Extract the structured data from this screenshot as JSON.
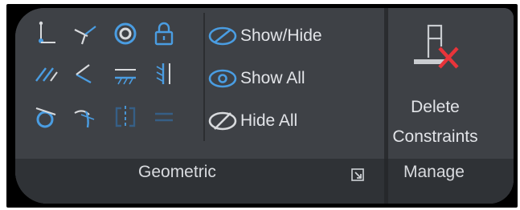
{
  "panels": {
    "geometric": {
      "title": "Geometric",
      "constraint_icons": [
        "coincident-icon",
        "collinear-icon",
        "concentric-icon",
        "fix-icon",
        "parallel-icon",
        "perpendicular-icon",
        "horizontal-icon",
        "vertical-icon",
        "tangent-icon",
        "smooth-icon",
        "symmetric-icon",
        "equal-icon"
      ],
      "display": {
        "show_hide": "Show/Hide",
        "show_all": "Show All",
        "hide_all": "Hide All"
      }
    },
    "manage": {
      "title": "Manage",
      "delete_line1": "Delete",
      "delete_line2": "Constraints"
    }
  },
  "colors": {
    "accent": "#4a9de2",
    "accent_dim": "#365f86",
    "delete_x": "#e8343a",
    "panel_bg": "#3e4146",
    "title_bg": "#2f3236"
  }
}
